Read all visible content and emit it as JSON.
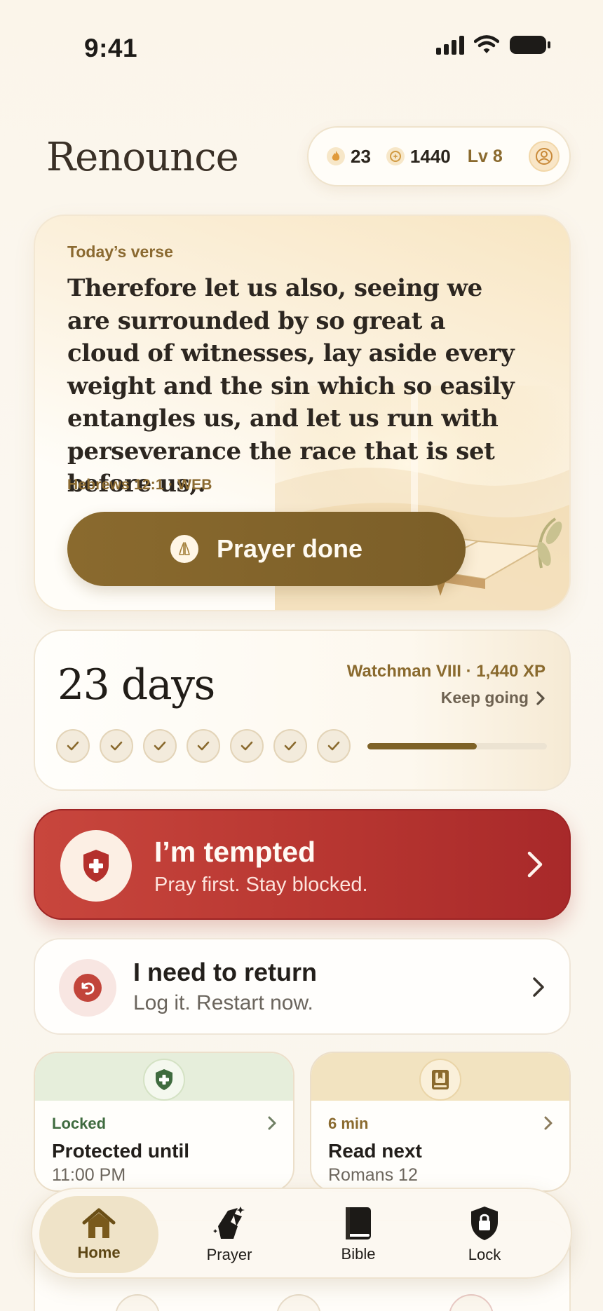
{
  "status_bar": {
    "time": "9:41"
  },
  "header": {
    "logo": "Renounce",
    "streak": "23",
    "points": "1440",
    "level": "Lv 8"
  },
  "verse": {
    "label": "Today’s verse",
    "text": "Therefore let us also, seeing we are surrounded by so great a cloud of witnesses, lay aside every weight and the sin which so easily entangles us, and let us run with perseverance the race that is set before us,.",
    "reference": "Hebrews 12:1 · WEB",
    "button_label": "Prayer done"
  },
  "streak": {
    "days": "23 days",
    "level_text": "Watchman VIII · 1,440 XP",
    "keep_going": "Keep going",
    "checks_completed": 7,
    "progress_fraction": 0.61
  },
  "tempted": {
    "title": "I’m tempted",
    "subtitle": "Pray first. Stay blocked."
  },
  "return": {
    "title": "I need to return",
    "subtitle": "Log it. Restart now."
  },
  "locked_card": {
    "kicker": "Locked",
    "title": "Protected until",
    "subtitle": "11:00 PM"
  },
  "read_card": {
    "kicker": "6 min",
    "title": "Read next",
    "subtitle": "Romans 12"
  },
  "tabs": [
    {
      "label": "Home",
      "icon": "home-icon",
      "active": true
    },
    {
      "label": "Prayer",
      "icon": "praying-hands-icon",
      "active": false
    },
    {
      "label": "Bible",
      "icon": "bible-icon",
      "active": false
    },
    {
      "label": "Lock",
      "icon": "lock-shield-icon",
      "active": false
    }
  ],
  "colors": {
    "accent": "#8a6a2e",
    "danger": "#b63530",
    "success": "#3f6b3f",
    "background": "#fbf7f0"
  }
}
